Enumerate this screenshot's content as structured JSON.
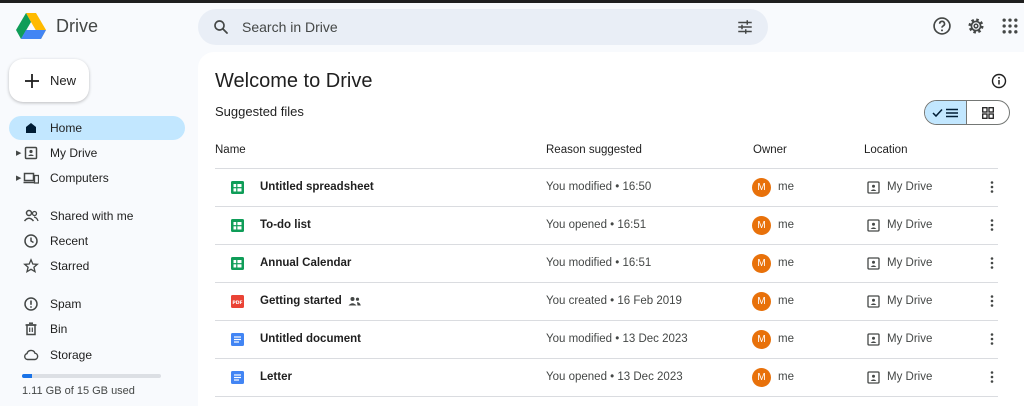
{
  "app": {
    "name": "Drive"
  },
  "search": {
    "placeholder": "Search in Drive"
  },
  "sidebar": {
    "new_label": "New",
    "items": [
      {
        "label": "Home",
        "icon": "home-icon",
        "active": true
      },
      {
        "label": "My Drive",
        "icon": "my-drive-icon",
        "expandable": true
      },
      {
        "label": "Computers",
        "icon": "computers-icon",
        "expandable": true
      },
      {
        "label": "Shared with me",
        "icon": "shared-icon"
      },
      {
        "label": "Recent",
        "icon": "clock-icon"
      },
      {
        "label": "Starred",
        "icon": "star-icon"
      },
      {
        "label": "Spam",
        "icon": "spam-icon"
      },
      {
        "label": "Bin",
        "icon": "bin-icon"
      },
      {
        "label": "Storage",
        "icon": "cloud-icon"
      }
    ],
    "storage": {
      "used_fraction": 0.074,
      "text": "1.11 GB of 15 GB used"
    }
  },
  "main": {
    "title": "Welcome to Drive",
    "subtitle": "Suggested files",
    "columns": {
      "name": "Name",
      "reason": "Reason suggested",
      "owner": "Owner",
      "location": "Location"
    },
    "files": [
      {
        "name": "Untitled spreadsheet",
        "type": "sheets",
        "reason": "You modified • 16:50",
        "owner": "me",
        "owner_initial": "M",
        "location": "My Drive",
        "shared": false
      },
      {
        "name": "To-do list",
        "type": "sheets",
        "reason": "You opened • 16:51",
        "owner": "me",
        "owner_initial": "M",
        "location": "My Drive",
        "shared": false
      },
      {
        "name": "Annual Calendar",
        "type": "sheets",
        "reason": "You modified • 16:51",
        "owner": "me",
        "owner_initial": "M",
        "location": "My Drive",
        "shared": false
      },
      {
        "name": "Getting started",
        "type": "pdf",
        "reason": "You created • 16 Feb 2019",
        "owner": "me",
        "owner_initial": "M",
        "location": "My Drive",
        "shared": true
      },
      {
        "name": "Untitled document",
        "type": "docs",
        "reason": "You modified • 13 Dec 2023",
        "owner": "me",
        "owner_initial": "M",
        "location": "My Drive",
        "shared": false
      },
      {
        "name": "Letter",
        "type": "docs",
        "reason": "You opened • 13 Dec 2023",
        "owner": "me",
        "owner_initial": "M",
        "location": "My Drive",
        "shared": false
      }
    ]
  },
  "colors": {
    "accent": "#c2e7ff",
    "sheets": "#0f9d58",
    "pdf": "#ea4335",
    "docs": "#4285f4",
    "avatar": "#e8710a"
  }
}
